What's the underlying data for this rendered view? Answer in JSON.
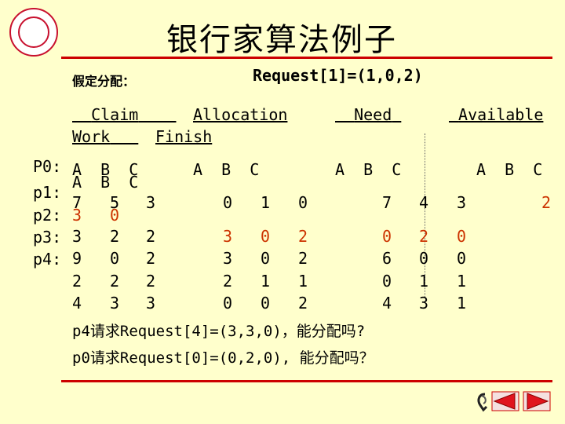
{
  "title": "银行家算法例子",
  "subtitle": "假定分配：",
  "request": "Request[1]=(1,0,2)",
  "headers": {
    "claim": "Claim",
    "allocation": "Allocation",
    "need": "Need",
    "available": "Available",
    "work": "Work",
    "finish": "Finish"
  },
  "abc_labels": {
    "claim": "A  B  C",
    "claim2": "A  B  C",
    "allocation": "A  B  C",
    "need": "A  B  C",
    "available": "A  B  C"
  },
  "processes": [
    "P0:",
    "p1:",
    "p2:",
    "p3:",
    "p4:"
  ],
  "rows": [
    {
      "claim": [
        "7",
        "5",
        "3"
      ],
      "allocation": [
        "0",
        "1",
        "0"
      ],
      "need": [
        "7",
        "4",
        "3"
      ]
    },
    {
      "claim": [
        "3",
        "0",
        ""
      ],
      "allocation": [
        "3",
        "0",
        "2"
      ],
      "need": [
        "0",
        "2",
        "0"
      ]
    },
    {
      "claim": [
        "3",
        "2",
        "2"
      ],
      "allocation": [
        "3",
        "0",
        "2"
      ],
      "need": [
        "6",
        "0",
        "0"
      ]
    },
    {
      "claim": [
        "9",
        "0",
        "2"
      ],
      "allocation": [
        "2",
        "1",
        "1"
      ],
      "need": [
        "0",
        "1",
        "1"
      ]
    },
    {
      "claim": [
        "2",
        "2",
        "2"
      ],
      "allocation": [
        "0",
        "0",
        "2"
      ],
      "need": [
        "4",
        "3",
        "1"
      ]
    }
  ],
  "extra_row": [
    "4",
    "3",
    "3"
  ],
  "available_value": "2",
  "questions": [
    "p4请求Request[4]=(3,3,0)，能分配吗?",
    "p0请求Request[0]=(0,2,0), 能分配吗？"
  ],
  "colors": {
    "accent_red": "#cc0000",
    "value_red": "#cc3300",
    "background": "#ffffcc"
  },
  "nav_icons": [
    "return-icon",
    "prev-icon",
    "next-icon"
  ]
}
